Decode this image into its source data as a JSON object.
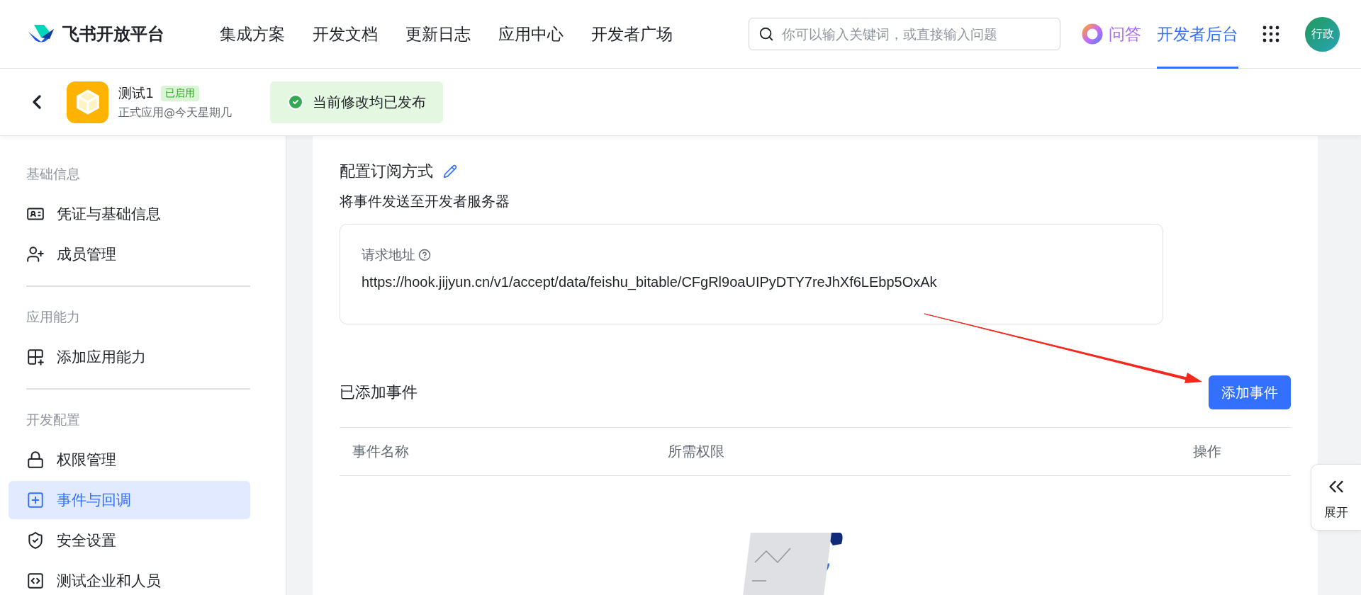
{
  "header": {
    "logo_text": "飞书开放平台",
    "nav": [
      {
        "label": "集成方案",
        "selected": false
      },
      {
        "label": "开发文档",
        "selected": false
      },
      {
        "label": "更新日志",
        "selected": false
      },
      {
        "label": "应用中心",
        "selected": false
      },
      {
        "label": "开发者广场",
        "selected": false
      }
    ],
    "search": {
      "placeholder": "你可以输入关键词，或直接输入问题"
    },
    "qa": "问答",
    "console": {
      "label": "开发者后台",
      "selected": true
    },
    "avatar": "行政"
  },
  "app_bar": {
    "name": "测试1",
    "status": "已启用",
    "subtitle": "正式应用@今天星期几",
    "toast": "当前修改均已发布"
  },
  "sidebar": {
    "sections": [
      {
        "title": "基础信息",
        "items": [
          {
            "label": "凭证与基础信息",
            "kind": "credential",
            "selected": false
          },
          {
            "label": "成员管理",
            "kind": "member",
            "selected": false
          }
        ]
      },
      {
        "title": "应用能力",
        "items": [
          {
            "label": "添加应用能力",
            "kind": "capability",
            "selected": false
          }
        ]
      },
      {
        "title": "开发配置",
        "items": [
          {
            "label": "权限管理",
            "kind": "permission",
            "selected": false
          },
          {
            "label": "事件与回调",
            "kind": "event",
            "selected": true
          },
          {
            "label": "安全设置",
            "kind": "security",
            "selected": false
          },
          {
            "label": "测试企业和人员",
            "kind": "test",
            "selected": false
          }
        ]
      }
    ]
  },
  "subscription": {
    "title": "配置订阅方式",
    "description": "将事件发送至开发者服务器",
    "url_label": "请求地址",
    "url": "https://hook.jijyun.cn/v1/accept/data/feishu_bitable/CFgRl9oaUIPyDTY7reJhXf6LEbp5OxAk"
  },
  "events": {
    "title": "已添加事件",
    "add_button": "添加事件",
    "columns": [
      "事件名称",
      "所需权限",
      "操作"
    ]
  },
  "expand_panel": {
    "label": "展开"
  }
}
